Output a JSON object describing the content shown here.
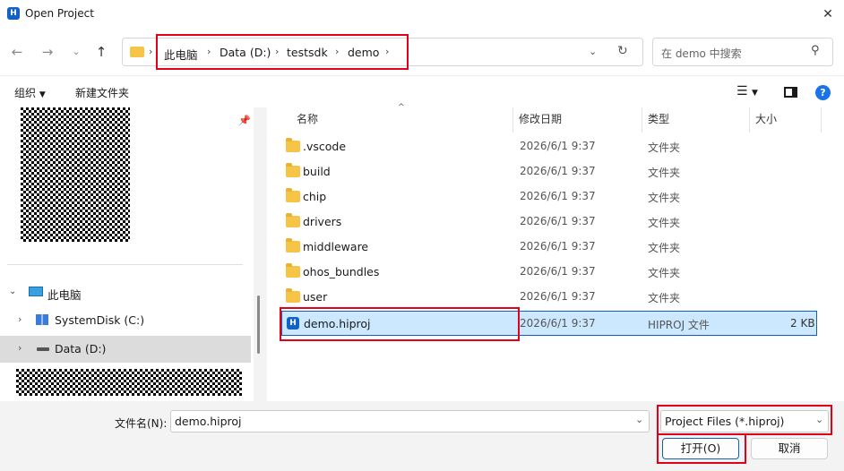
{
  "window": {
    "title": "Open Project",
    "app_icon_letter": "H"
  },
  "nav": {
    "breadcrumbs": [
      "此电脑",
      "Data (D:)",
      "testsdk",
      "demo"
    ],
    "search_placeholder": "在 demo 中搜索"
  },
  "toolbar": {
    "organize": "组织",
    "new_folder": "新建文件夹"
  },
  "sidebar": {
    "this_pc": "此电脑",
    "drives": [
      {
        "label": "SystemDisk (C:)"
      },
      {
        "label": "Data (D:)"
      }
    ]
  },
  "columns": {
    "name": "名称",
    "modified": "修改日期",
    "type": "类型",
    "size": "大小"
  },
  "files": [
    {
      "name": ".vscode",
      "date": "2026/6/1 9:37",
      "type": "文件夹",
      "size": ""
    },
    {
      "name": "build",
      "date": "2026/6/1 9:37",
      "type": "文件夹",
      "size": ""
    },
    {
      "name": "chip",
      "date": "2026/6/1 9:37",
      "type": "文件夹",
      "size": ""
    },
    {
      "name": "drivers",
      "date": "2026/6/1 9:37",
      "type": "文件夹",
      "size": ""
    },
    {
      "name": "middleware",
      "date": "2026/6/1 9:37",
      "type": "文件夹",
      "size": ""
    },
    {
      "name": "ohos_bundles",
      "date": "2026/6/1 9:37",
      "type": "文件夹",
      "size": ""
    },
    {
      "name": "user",
      "date": "2026/6/1 9:37",
      "type": "文件夹",
      "size": ""
    },
    {
      "name": "demo.hiproj",
      "date": "2026/6/1 9:37",
      "type": "HIPROJ 文件",
      "size": "2 KB"
    }
  ],
  "footer": {
    "filename_label": "文件名(N):",
    "filename_value": "demo.hiproj",
    "filetype": "Project Files (*.hiproj)",
    "open": "打开(O)",
    "cancel": "取消"
  },
  "colors": {
    "highlight": "#e3001b",
    "selection": "#cce8ff",
    "accent": "#1261c7"
  }
}
